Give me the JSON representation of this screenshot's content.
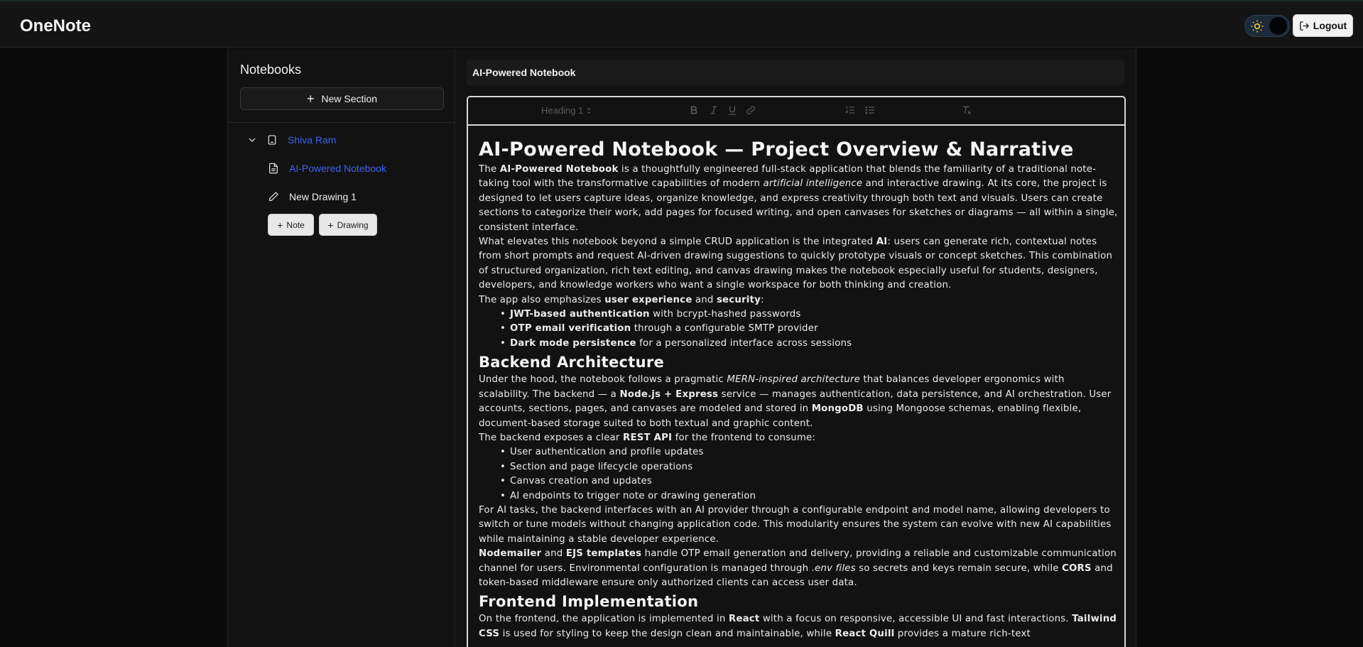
{
  "app": {
    "brand": "OneNote"
  },
  "header": {
    "logout_label": "Logout"
  },
  "sidebar": {
    "title": "Notebooks",
    "new_section_label": "New Section",
    "section": {
      "label": "Shiva Ram"
    },
    "pages": [
      {
        "label": "AI-Powered Notebook"
      },
      {
        "label": "New Drawing 1"
      }
    ],
    "note_button": "Note",
    "drawing_button": "Drawing"
  },
  "editor": {
    "title_value": "AI-Powered Notebook",
    "toolbar": {
      "heading_value": "Heading 1"
    },
    "content": {
      "h1": "AI-Powered Notebook — Project Overview & Narrative",
      "p1": {
        "a": "The ",
        "b": "AI-Powered Notebook",
        "c": " is a thoughtfully engineered full-stack application that blends the familiarity of a traditional note-taking tool with the transformative capabilities of modern ",
        "d": "artificial intelligence",
        "e": " and interactive drawing. At its core, the project is designed to let users capture ideas, organize knowledge, and express creativity through both text and visuals. Users can create sections to categorize their work, add pages for focused writing, and open canvases for sketches or diagrams — all within a single, consistent interface."
      },
      "p2": {
        "a": "What elevates this notebook beyond a simple CRUD application is the integrated ",
        "b": "AI",
        "c": ": users can generate rich, contextual notes from short prompts and request AI-driven drawing suggestions to quickly prototype visuals or concept sketches. This combination of structured organization, rich text editing, and canvas drawing makes the notebook especially useful for students, designers, developers, and knowledge workers who want a single workspace for both thinking and creation."
      },
      "p3": {
        "a": "The app also emphasizes ",
        "b": "user experience",
        "c": " and ",
        "d": "security",
        "e": ":"
      },
      "list1": [
        {
          "b": "JWT-based authentication",
          "t": " with bcrypt-hashed passwords"
        },
        {
          "b": "OTP email verification",
          "t": " through a configurable SMTP provider"
        },
        {
          "b": "Dark mode persistence",
          "t": " for a personalized interface across sessions"
        }
      ],
      "h2a": "Backend Architecture",
      "p4": {
        "a": "Under the hood, the notebook follows a pragmatic ",
        "b": "MERN-inspired architecture",
        "c": " that balances developer ergonomics with scalability. The backend — a ",
        "d": "Node.js + Express",
        "e": " service — manages authentication, data persistence, and AI orchestration. User accounts, sections, pages, and canvases are modeled and stored in ",
        "f": "MongoDB",
        "g": " using Mongoose schemas, enabling flexible, document-based storage suited to both textual and graphic content."
      },
      "p5": {
        "a": "The backend exposes a clear ",
        "b": "REST API",
        "c": " for the frontend to consume:"
      },
      "list2": [
        "User authentication and profile updates",
        "Section and page lifecycle operations",
        "Canvas creation and updates",
        "AI endpoints to trigger note or drawing generation"
      ],
      "p6": "For AI tasks, the backend interfaces with an AI provider through a configurable endpoint and model name, allowing developers to switch or tune models without changing application code. This modularity ensures the system can evolve with new AI capabilities while maintaining a stable developer experience.",
      "p7": {
        "a": "Nodemailer",
        "b": " and ",
        "c": "EJS templates",
        "d": " handle OTP email generation and delivery, providing a reliable and customizable communication channel for users. Environmental configuration is managed through ",
        "e": ".env files",
        "f": " so secrets and keys remain secure, while ",
        "g": "CORS",
        "h": " and token-based middleware ensure only authorized clients can access user data."
      },
      "h2b": "Frontend Implementation",
      "p8": {
        "a": "On the frontend, the application is implemented in ",
        "b": "React",
        "c": " with a focus on responsive, accessible UI and fast interactions. ",
        "d": "Tailwind CSS",
        "e": " is used for styling to keep the design clean and maintainable, while ",
        "f": "React Quill",
        "g": " provides a mature rich-text"
      }
    }
  },
  "colors": {
    "accent_link": "#3b63f0",
    "background": "#0a0a0a",
    "panel": "#121212"
  }
}
